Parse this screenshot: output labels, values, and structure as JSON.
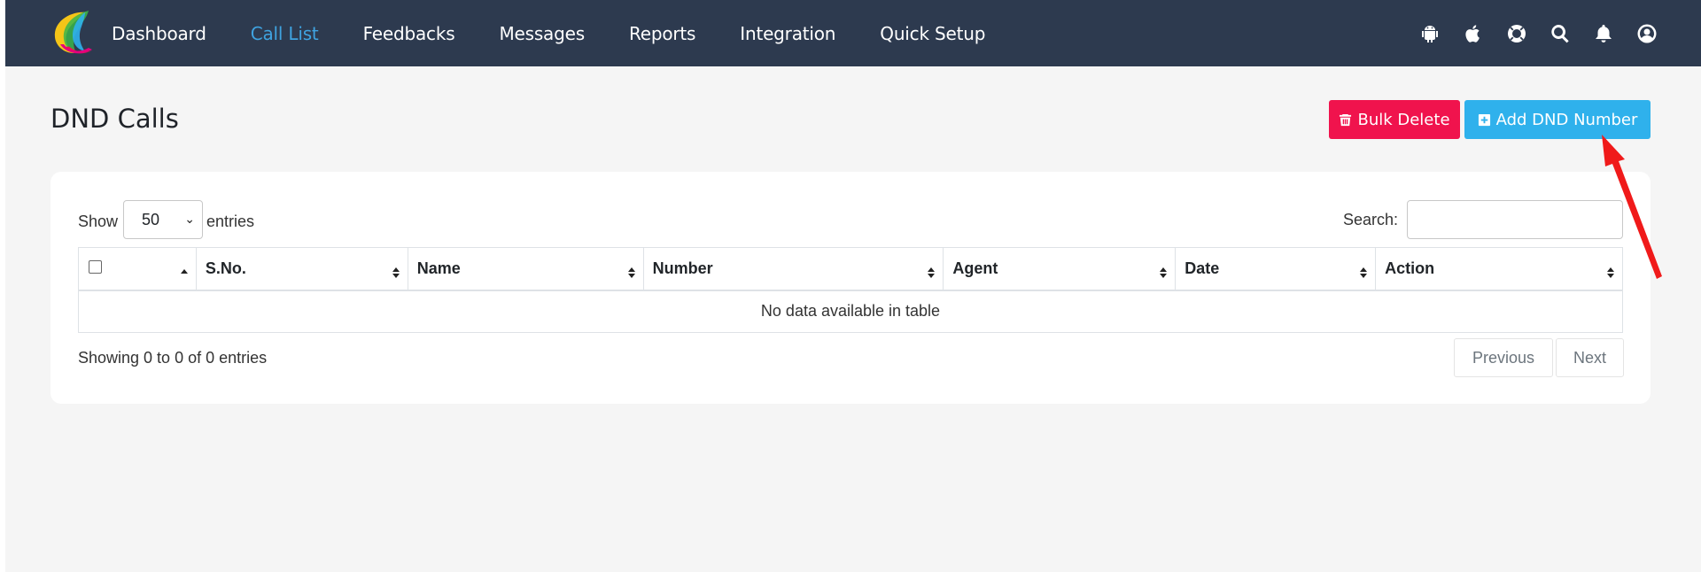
{
  "nav": {
    "items": [
      {
        "label": "Dashboard",
        "active": false
      },
      {
        "label": "Call List",
        "active": true
      },
      {
        "label": "Feedbacks",
        "active": false
      },
      {
        "label": "Messages",
        "active": false
      },
      {
        "label": "Reports",
        "active": false
      },
      {
        "label": "Integration",
        "active": false
      },
      {
        "label": "Quick Setup",
        "active": false
      }
    ],
    "icons": [
      "android-icon",
      "apple-icon",
      "lifebuoy-icon",
      "search-icon",
      "bell-icon",
      "user-circle-icon"
    ],
    "bg_color": "#2d3a4f",
    "active_color": "#3fa3e0"
  },
  "page": {
    "title": "DND Calls"
  },
  "actions": {
    "bulk_delete": "Bulk Delete",
    "add_dnd": "Add DND Number",
    "bulk_delete_color": "#f0134d",
    "add_dnd_color": "#2fb1ec"
  },
  "table_controls": {
    "show_label": "Show",
    "page_size": "50",
    "entries_label": "entries",
    "search_label": "Search:",
    "search_value": ""
  },
  "table": {
    "columns": [
      "",
      "S.No.",
      "Name",
      "Number",
      "Agent",
      "Date",
      "Action"
    ],
    "empty_message": "No data available in table"
  },
  "footer": {
    "showing": "Showing 0 to 0 of 0 entries",
    "previous": "Previous",
    "next": "Next"
  }
}
